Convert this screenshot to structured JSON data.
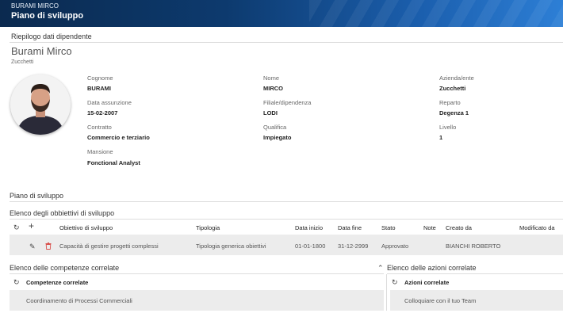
{
  "header": {
    "user_name": "BURAMI MIRCO",
    "page_title": "Piano di sviluppo"
  },
  "summary": {
    "section_title": "Riepilogo dati dipendente",
    "full_name": "Burami Mirco",
    "company": "Zucchetti",
    "fields": {
      "cognome": {
        "label": "Cognome",
        "value": "BURAMI"
      },
      "nome": {
        "label": "Nome",
        "value": "MIRCO"
      },
      "azienda": {
        "label": "Azienda/ente",
        "value": "Zucchetti"
      },
      "data_assunzione": {
        "label": "Data assunzione",
        "value": "15-02-2007"
      },
      "filiale": {
        "label": "Filiale/dipendenza",
        "value": "LODI"
      },
      "reparto": {
        "label": "Reparto",
        "value": "Degenza 1"
      },
      "contratto": {
        "label": "Contratto",
        "value": "Commercio e terziario"
      },
      "qualifica": {
        "label": "Qualifica",
        "value": "Impiegato"
      },
      "livello": {
        "label": "Livello",
        "value": "1"
      },
      "mansione": {
        "label": "Mansione",
        "value": "Fonctional Analyst"
      }
    }
  },
  "plan": {
    "section_title": "Piano di sviluppo",
    "objectives": {
      "title": "Elenco degli obbiettivi di sviluppo",
      "columns": [
        "Obiettivo di sviluppo",
        "Tipologia",
        "Data inizio",
        "Data fine",
        "Stato",
        "Note",
        "Creato da",
        "Modificato da"
      ],
      "rows": [
        {
          "obiettivo": "Capacità di gestire progetti complessi",
          "tipologia": "Tipologia generica obiettivi",
          "data_inizio": "01-01-1800",
          "data_fine": "31-12-2999",
          "stato": "Approvato",
          "note": "",
          "creato_da": "BIANCHI ROBERTO",
          "modificato_da": ""
        }
      ]
    },
    "competenze": {
      "title": "Elenco delle competenze correlate",
      "column": "Competenze correlate",
      "rows": [
        "Coordinamento di Processi Commerciali"
      ]
    },
    "azioni": {
      "title": "Elenco delle azioni correlate",
      "column": "Azioni correlate",
      "rows": [
        "Colloquiare con il tuo Team"
      ]
    }
  },
  "icons": {
    "refresh": "refresh-icon",
    "add": "add-icon",
    "edit": "pencil-icon",
    "delete": "trash-icon",
    "collapse": "chevron-up-icon"
  },
  "colors": {
    "header_dark": "#0b2a4f",
    "header_light": "#2d7fd6",
    "row_background": "#ececec",
    "delete_red": "#d9534f"
  }
}
